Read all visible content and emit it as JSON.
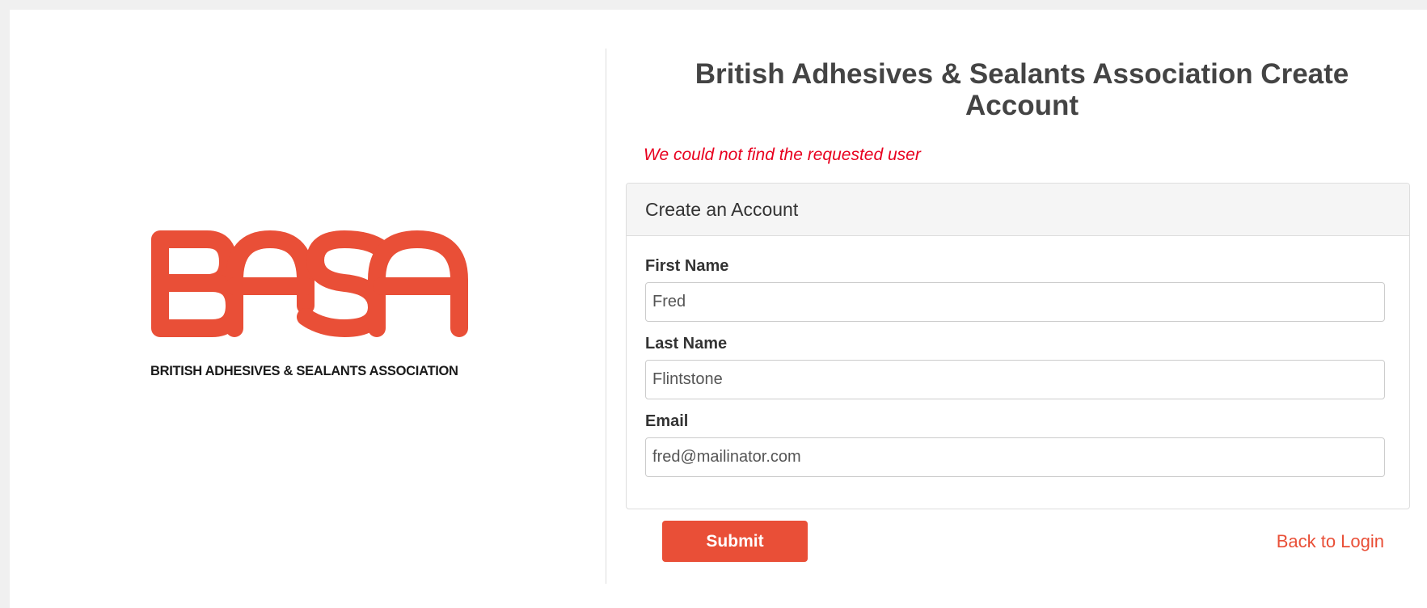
{
  "brand": {
    "logo_text": "BASA",
    "tagline": "BRITISH ADHESIVES & SEALANTS ASSOCIATION",
    "color": "#e94f37"
  },
  "page": {
    "title": "British Adhesives & Sealants Association Create Account",
    "error_message": "We could not find the requested user"
  },
  "form": {
    "header": "Create an Account",
    "fields": [
      {
        "label": "First Name",
        "value": "Fred"
      },
      {
        "label": "Last Name",
        "value": "Flintstone"
      },
      {
        "label": "Email",
        "value": "fred@mailinator.com"
      }
    ],
    "submit_label": "Submit",
    "back_link_label": "Back to Login"
  }
}
